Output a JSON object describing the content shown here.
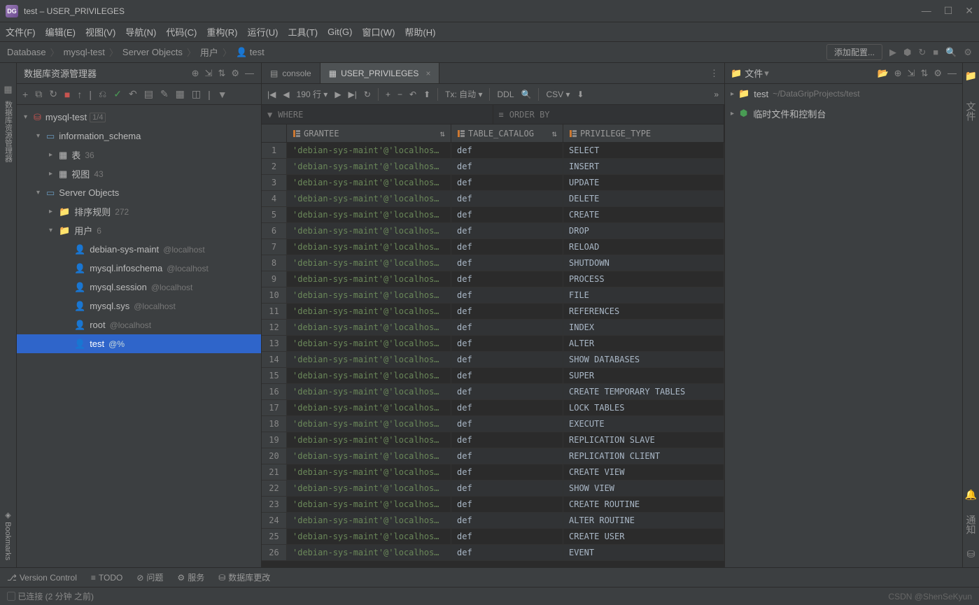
{
  "title": "test – USER_PRIVILEGES",
  "app_icon_text": "DG",
  "menubar": [
    "文件(F)",
    "编辑(E)",
    "视图(V)",
    "导航(N)",
    "代码(C)",
    "重构(R)",
    "运行(U)",
    "工具(T)",
    "Git(G)",
    "窗口(W)",
    "帮助(H)"
  ],
  "breadcrumb": [
    "Database",
    "mysql-test",
    "Server Objects",
    "用户",
    "test"
  ],
  "add_config": "添加配置...",
  "sidebar": {
    "title": "数据库资源管理器",
    "left_gutter_label": "数据库资源管理器",
    "bookmarks_label": "Bookmarks",
    "tree": {
      "root": "mysql-test",
      "root_count": "1/4",
      "info_schema": "information_schema",
      "table_label": "表",
      "table_count": "36",
      "view_label": "视图",
      "view_count": "43",
      "server_objects": "Server Objects",
      "sort_label": "排序规则",
      "sort_count": "272",
      "user_label": "用户",
      "user_count": "6",
      "users": [
        {
          "name": "debian-sys-maint",
          "host": "@localhost"
        },
        {
          "name": "mysql.infoschema",
          "host": "@localhost"
        },
        {
          "name": "mysql.session",
          "host": "@localhost"
        },
        {
          "name": "mysql.sys",
          "host": "@localhost"
        },
        {
          "name": "root",
          "host": "@localhost"
        },
        {
          "name": "test",
          "host": "@%"
        }
      ]
    }
  },
  "tabs": [
    {
      "label": "console",
      "active": false
    },
    {
      "label": "USER_PRIVILEGES",
      "active": true
    }
  ],
  "datatoolbar": {
    "rows": "190 行",
    "tx": "Tx: 自动",
    "ddl": "DDL",
    "csv": "CSV"
  },
  "filterbar": {
    "where": "WHERE",
    "orderby": "ORDER BY"
  },
  "table": {
    "headers": [
      "GRANTEE",
      "TABLE_CATALOG",
      "PRIVILEGE_TYPE"
    ],
    "rows": [
      {
        "grantee": "'debian-sys-maint'@'localhos…",
        "catalog": "def",
        "priv": "SELECT"
      },
      {
        "grantee": "'debian-sys-maint'@'localhos…",
        "catalog": "def",
        "priv": "INSERT"
      },
      {
        "grantee": "'debian-sys-maint'@'localhos…",
        "catalog": "def",
        "priv": "UPDATE"
      },
      {
        "grantee": "'debian-sys-maint'@'localhos…",
        "catalog": "def",
        "priv": "DELETE"
      },
      {
        "grantee": "'debian-sys-maint'@'localhos…",
        "catalog": "def",
        "priv": "CREATE"
      },
      {
        "grantee": "'debian-sys-maint'@'localhos…",
        "catalog": "def",
        "priv": "DROP"
      },
      {
        "grantee": "'debian-sys-maint'@'localhos…",
        "catalog": "def",
        "priv": "RELOAD"
      },
      {
        "grantee": "'debian-sys-maint'@'localhos…",
        "catalog": "def",
        "priv": "SHUTDOWN"
      },
      {
        "grantee": "'debian-sys-maint'@'localhos…",
        "catalog": "def",
        "priv": "PROCESS"
      },
      {
        "grantee": "'debian-sys-maint'@'localhos…",
        "catalog": "def",
        "priv": "FILE"
      },
      {
        "grantee": "'debian-sys-maint'@'localhos…",
        "catalog": "def",
        "priv": "REFERENCES"
      },
      {
        "grantee": "'debian-sys-maint'@'localhos…",
        "catalog": "def",
        "priv": "INDEX"
      },
      {
        "grantee": "'debian-sys-maint'@'localhos…",
        "catalog": "def",
        "priv": "ALTER"
      },
      {
        "grantee": "'debian-sys-maint'@'localhos…",
        "catalog": "def",
        "priv": "SHOW DATABASES"
      },
      {
        "grantee": "'debian-sys-maint'@'localhos…",
        "catalog": "def",
        "priv": "SUPER"
      },
      {
        "grantee": "'debian-sys-maint'@'localhos…",
        "catalog": "def",
        "priv": "CREATE TEMPORARY TABLES"
      },
      {
        "grantee": "'debian-sys-maint'@'localhos…",
        "catalog": "def",
        "priv": "LOCK TABLES"
      },
      {
        "grantee": "'debian-sys-maint'@'localhos…",
        "catalog": "def",
        "priv": "EXECUTE"
      },
      {
        "grantee": "'debian-sys-maint'@'localhos…",
        "catalog": "def",
        "priv": "REPLICATION SLAVE"
      },
      {
        "grantee": "'debian-sys-maint'@'localhos…",
        "catalog": "def",
        "priv": "REPLICATION CLIENT"
      },
      {
        "grantee": "'debian-sys-maint'@'localhos…",
        "catalog": "def",
        "priv": "CREATE VIEW"
      },
      {
        "grantee": "'debian-sys-maint'@'localhos…",
        "catalog": "def",
        "priv": "SHOW VIEW"
      },
      {
        "grantee": "'debian-sys-maint'@'localhos…",
        "catalog": "def",
        "priv": "CREATE ROUTINE"
      },
      {
        "grantee": "'debian-sys-maint'@'localhos…",
        "catalog": "def",
        "priv": "ALTER ROUTINE"
      },
      {
        "grantee": "'debian-sys-maint'@'localhos…",
        "catalog": "def",
        "priv": "CREATE USER"
      },
      {
        "grantee": "'debian-sys-maint'@'localhos…",
        "catalog": "def",
        "priv": "EVENT"
      }
    ]
  },
  "rightpanel": {
    "file_label": "文件",
    "project": "test",
    "path": "~/DataGripProjects/test",
    "temp": "临时文件和控制台"
  },
  "bottombar": {
    "vc": "Version Control",
    "todo": "TODO",
    "problems": "问题",
    "services": "服务",
    "db_changes": "数据库更改"
  },
  "status": "已连接 (2 分钟 之前)",
  "watermark": "CSDN @ShenSeKyun"
}
